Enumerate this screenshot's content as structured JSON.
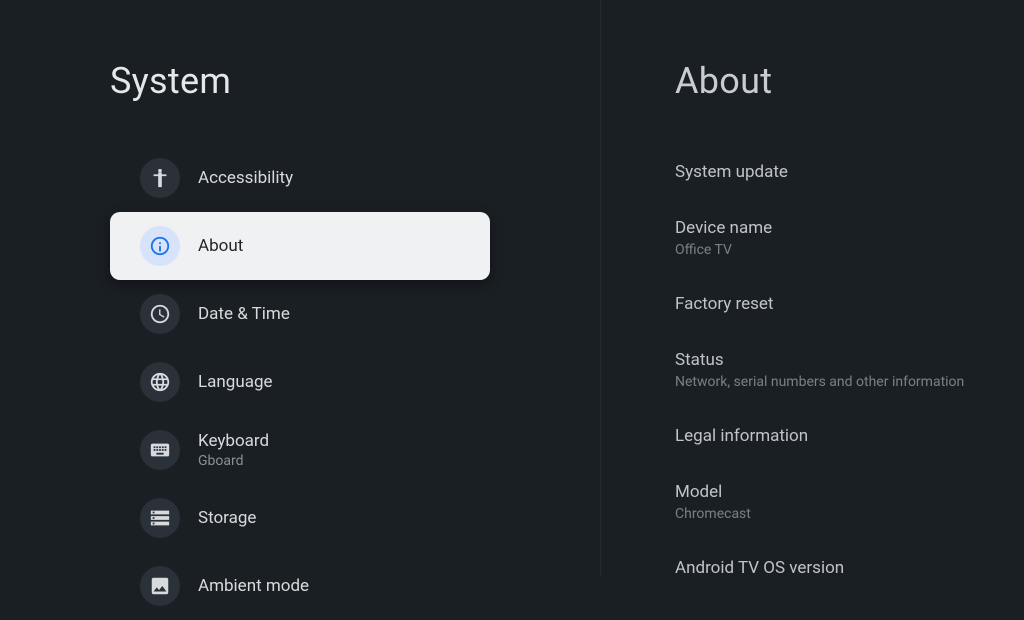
{
  "left": {
    "title": "System",
    "items": [
      {
        "label": "Accessibility",
        "sublabel": null,
        "icon": "accessibility",
        "selected": false
      },
      {
        "label": "About",
        "sublabel": null,
        "icon": "info",
        "selected": true
      },
      {
        "label": "Date & Time",
        "sublabel": null,
        "icon": "clock",
        "selected": false
      },
      {
        "label": "Language",
        "sublabel": null,
        "icon": "globe",
        "selected": false
      },
      {
        "label": "Keyboard",
        "sublabel": "Gboard",
        "icon": "keyboard",
        "selected": false
      },
      {
        "label": "Storage",
        "sublabel": null,
        "icon": "storage",
        "selected": false
      },
      {
        "label": "Ambient mode",
        "sublabel": null,
        "icon": "ambient",
        "selected": false
      }
    ]
  },
  "right": {
    "title": "About",
    "items": [
      {
        "label": "System update",
        "sublabel": null
      },
      {
        "label": "Device name",
        "sublabel": "Office TV"
      },
      {
        "label": "Factory reset",
        "sublabel": null
      },
      {
        "label": "Status",
        "sublabel": "Network, serial numbers and other information"
      },
      {
        "label": "Legal information",
        "sublabel": null
      },
      {
        "label": "Model",
        "sublabel": "Chromecast"
      },
      {
        "label": "Android TV OS version",
        "sublabel": null
      }
    ]
  }
}
